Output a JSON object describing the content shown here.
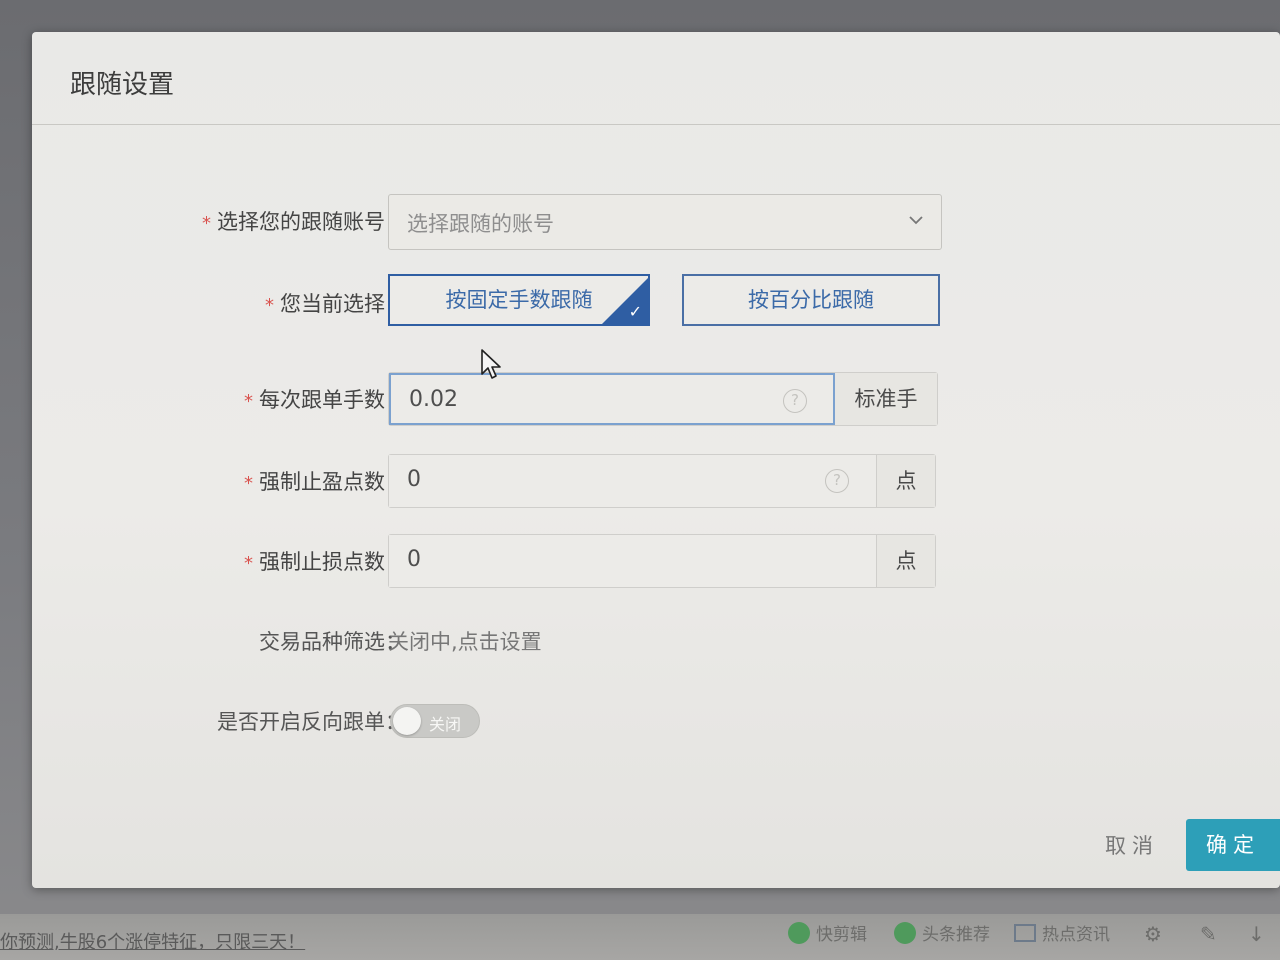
{
  "dialog": {
    "title": "跟随设置",
    "account": {
      "label": "选择您的跟随账号：",
      "placeholder": "选择跟随的账号"
    },
    "mode": {
      "label": "您当前选择：",
      "options": [
        "按固定手数跟随",
        "按百分比跟随"
      ],
      "selected": "按固定手数跟随"
    },
    "lots": {
      "label": "每次跟单手数：",
      "value": "0.02",
      "addon": "标准手"
    },
    "take_profit": {
      "label": "强制止盈点数：",
      "value": "0",
      "addon": "点"
    },
    "stop_loss": {
      "label": "强制止损点数：",
      "value": "0",
      "addon": "点"
    },
    "symbol_filter": {
      "label": "交易品种筛选：",
      "value": "关闭中,点击设置"
    },
    "reverse": {
      "label": "是否开启反向跟单：",
      "state": "关闭"
    },
    "required_mark": "*",
    "cancel_label": "取消",
    "ok_label": "确定"
  },
  "icons": {
    "help": "?",
    "check": "✓"
  },
  "taskbar": {
    "ticker": "你预测,牛股6个涨停特征，只限三天！",
    "items": [
      "快剪辑",
      "头条推荐",
      "热点资讯"
    ]
  },
  "colors": {
    "accent": "#2f5ea3",
    "ok_button": "#2d9fb8",
    "required": "#d9534f"
  }
}
